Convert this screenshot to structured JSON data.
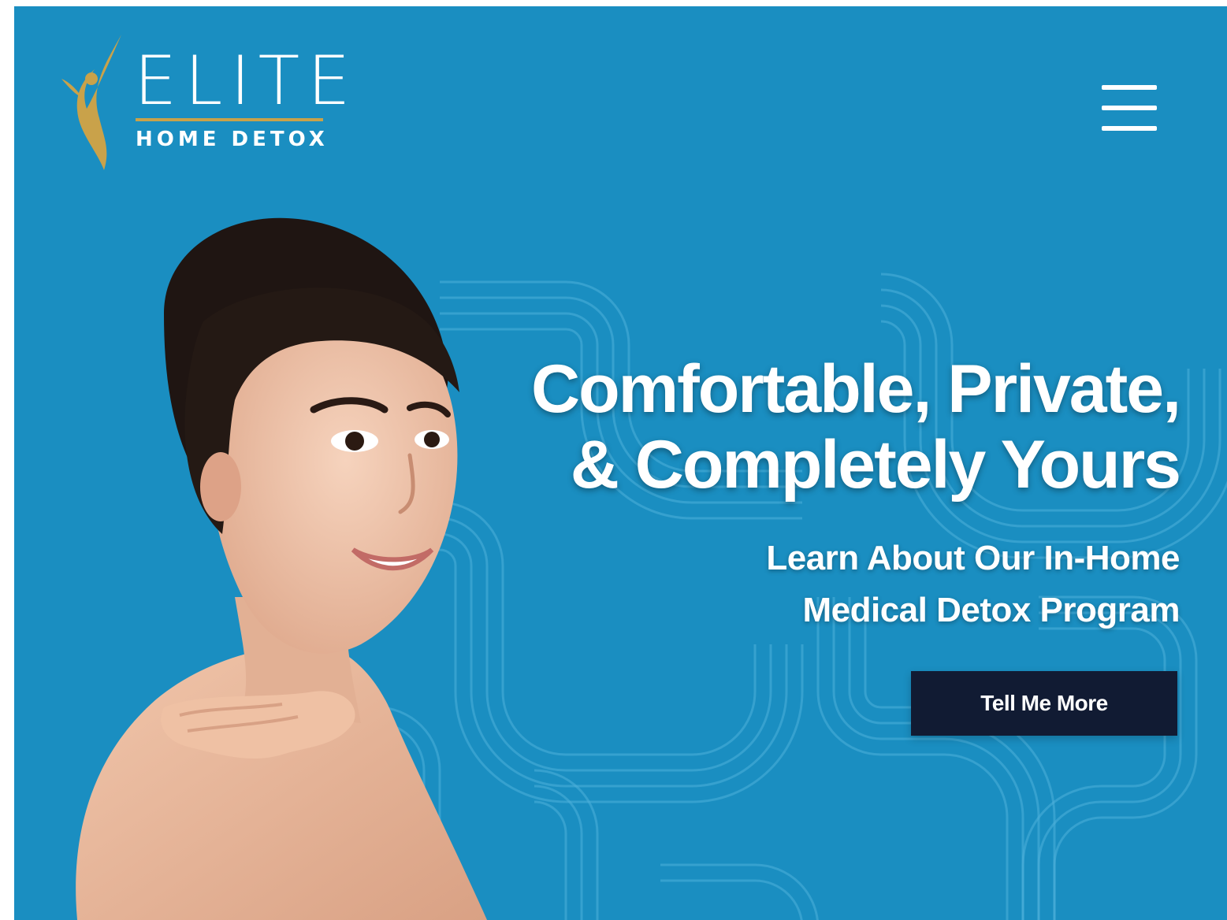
{
  "colors": {
    "background": "#1a8ec1",
    "brand_gold": "#c9a24a",
    "text": "#ffffff",
    "cta_background": "#111b33",
    "pattern_lines": "#4fb0da"
  },
  "header": {
    "logo": {
      "word": "ELITE",
      "subtitle": "HOME DETOX",
      "icon": "figure-mark-icon"
    },
    "menu_icon": "hamburger-menu-icon"
  },
  "hero": {
    "headline_line1": "Comfortable, Private,",
    "headline_line2": "& Completely Yours",
    "subheadline_line1": "Learn About Our In-Home",
    "subheadline_line2": "Medical Detox Program",
    "cta_label": "Tell Me More",
    "image": "smiling-woman-photo"
  }
}
